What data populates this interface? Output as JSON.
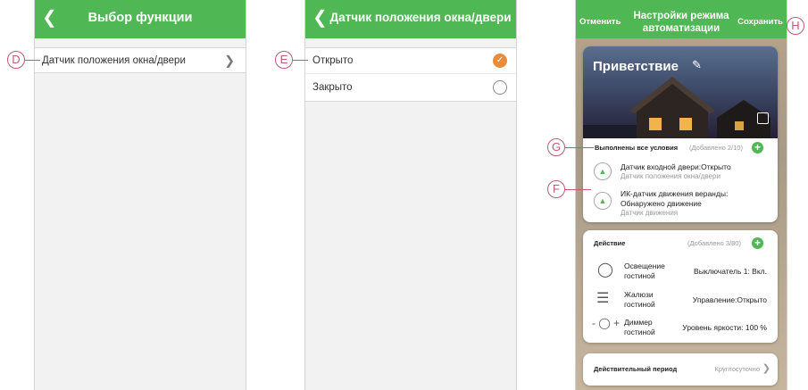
{
  "screen1": {
    "back_icon": "chevron-left-icon",
    "title": "Выбор функции",
    "item_label": "Датчик положения окна/двери",
    "callout": "D"
  },
  "screen2": {
    "back_icon": "chevron-left-icon",
    "title": "Датчик положения окна/двери",
    "options": [
      {
        "label": "Открыто",
        "selected": true
      },
      {
        "label": "Закрыто",
        "selected": false
      }
    ],
    "callout": "E"
  },
  "screen3": {
    "cancel": "Отменить",
    "title_line1": "Настройки режима",
    "title_line2": "автоматизации",
    "save": "Сохранить",
    "scene_name": "Приветствие",
    "conditions": {
      "title": "Выполнены все условия",
      "count": "(Добавлено 2/10)",
      "items": [
        {
          "title": "Датчик входной двери:Открыто",
          "subtitle": "Датчик положения окна/двери"
        },
        {
          "title_line1": "ИК-датчик движения веранды:",
          "title_line2": "Обнаружено движение",
          "subtitle": "Датчик движения"
        }
      ]
    },
    "actions": {
      "title": "Действие",
      "count": "(Добавлено 3/80)",
      "items": [
        {
          "icon": "light-bulb-icon",
          "name_line1": "Освещение",
          "name_line2": "гостиной",
          "value": "Выключатель 1: Вкл."
        },
        {
          "icon": "blinds-icon",
          "name_line1": "Жалюзи",
          "name_line2": "гостиной",
          "value": "Управление:Открыто"
        },
        {
          "icon": "dimmer-bulb-icon",
          "name_line1": "Диммер",
          "name_line2": "гостиной",
          "value": "Уровень яркости: 100 %"
        }
      ]
    },
    "period": {
      "label": "Действительный период",
      "value": "Круглосуточно"
    },
    "callouts": {
      "g": "G",
      "f": "F",
      "h": "H"
    }
  },
  "colors": {
    "accent": "#4fb754",
    "callout": "#c15a78",
    "background": "#f2f2f2"
  }
}
